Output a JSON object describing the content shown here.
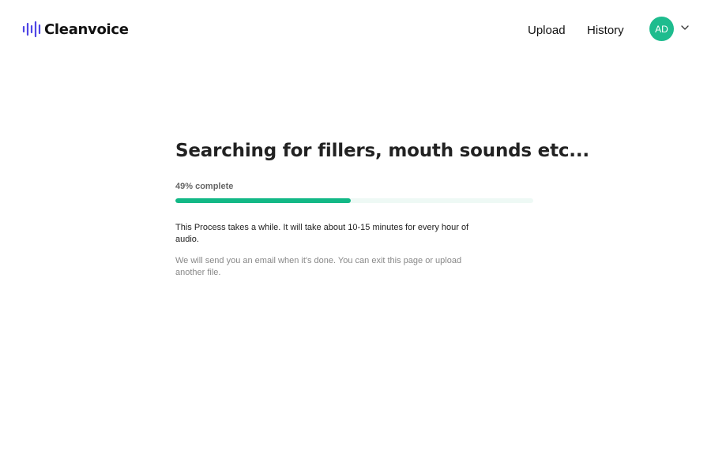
{
  "brand": {
    "name": "Cleanvoice",
    "icon": "waveform-icon",
    "accent_color": "#4f46e5"
  },
  "nav": {
    "upload_label": "Upload",
    "history_label": "History"
  },
  "user": {
    "initials": "AD",
    "avatar_color": "#1ebc8e",
    "menu_icon": "chevron-down-icon"
  },
  "processing": {
    "title": "Searching for fillers, mouth sounds etc...",
    "progress_label": "49% complete",
    "progress_percent": 49,
    "progress_color": "#12b886",
    "track_color": "#eef9f5",
    "info_text": "This Process takes a while. It will take about 10-15 minutes for every hour of audio.",
    "note_text": "We will send you an email when it's done. You can exit this page or upload another file."
  }
}
